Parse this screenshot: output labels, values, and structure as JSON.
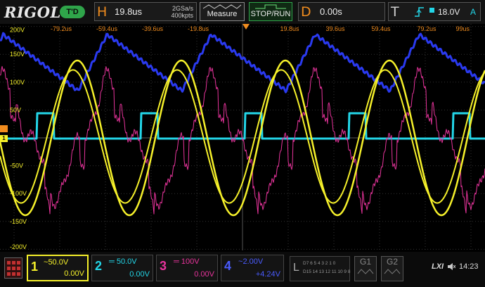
{
  "brand": "RIGOL",
  "mode_badge": "T'D",
  "horizontal": {
    "letter": "H",
    "timebase": "19.8us",
    "sample_rate": "2GSa/s",
    "memory": "400kpts"
  },
  "measure_label": "Measure",
  "run_label": "STOP/RUN",
  "delay": {
    "letter": "D",
    "value": "0.00s"
  },
  "trigger": {
    "letter": "T",
    "level": "18.0V",
    "source": "A"
  },
  "time_axis": [
    "-79.2us",
    "-59.4us",
    "-39.6us",
    "-19.8us",
    "19.8us",
    "39.6us",
    "59.4us",
    "79.2us",
    "99us"
  ],
  "volt_axis": [
    "200V",
    "150V",
    "100V",
    "50V",
    "-50V",
    "-100V",
    "-150V",
    "-200V"
  ],
  "channels": [
    {
      "num": "1",
      "scale": "50.0V",
      "offset": "0.00V",
      "color": "#f5f02a"
    },
    {
      "num": "2",
      "scale": "50.0V",
      "offset": "0.00V",
      "color": "#23d6e8"
    },
    {
      "num": "3",
      "scale": "100V",
      "offset": "0.00V",
      "color": "#e8349c"
    },
    {
      "num": "4",
      "scale": "2.00V",
      "offset": "+4.24V",
      "color": "#2a3af0"
    }
  ],
  "logic": {
    "letter": "L",
    "row1": "D7 6 5 4 3 2 1 0",
    "row2": "D15 14 13 12 11 10 9 8"
  },
  "g1_label": "G1",
  "g2_label": "G2",
  "lxi_label": "LXI",
  "clock": "14:23"
}
